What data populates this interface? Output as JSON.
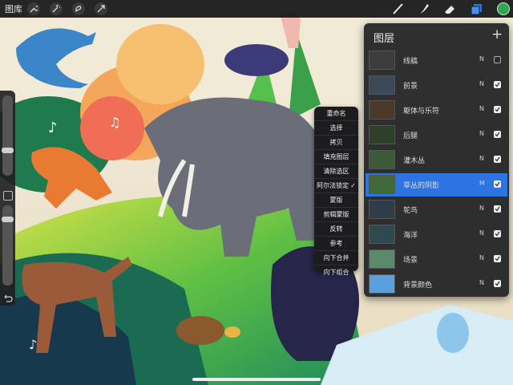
{
  "topbar": {
    "gallery_label": "图库",
    "left_icons": [
      "wrench-icon",
      "magic-wand-icon",
      "selection-icon",
      "transform-icon"
    ],
    "right_tools": [
      "brush-icon",
      "smudge-icon",
      "eraser-icon",
      "layers-icon"
    ],
    "current_color": "#2ea84a"
  },
  "context_menu": {
    "items": [
      {
        "label": "重命名"
      },
      {
        "label": "选择"
      },
      {
        "label": "拷贝"
      },
      {
        "label": "填充图层"
      },
      {
        "label": "清除选区"
      },
      {
        "label": "阿尔法锁定",
        "checked": "✓"
      },
      {
        "label": "蒙版"
      },
      {
        "label": "剪辑蒙版"
      },
      {
        "label": "反转"
      },
      {
        "label": "参考"
      },
      {
        "label": "向下合并"
      },
      {
        "label": "向下组合"
      }
    ]
  },
  "layers_panel": {
    "title": "图层",
    "add_symbol": "+",
    "layers": [
      {
        "name": "线稿",
        "mode": "N",
        "visible": false,
        "selected": false
      },
      {
        "name": "前景",
        "mode": "N",
        "visible": true,
        "selected": false
      },
      {
        "name": "躯体与乐符",
        "mode": "N",
        "visible": true,
        "selected": false
      },
      {
        "name": "后腿",
        "mode": "N",
        "visible": true,
        "selected": false
      },
      {
        "name": "灌木丛",
        "mode": "N",
        "visible": true,
        "selected": false
      },
      {
        "name": "草丛的阴影",
        "mode": "M",
        "visible": true,
        "selected": true
      },
      {
        "name": "鸵鸟",
        "mode": "N",
        "visible": true,
        "selected": false
      },
      {
        "name": "海洋",
        "mode": "N",
        "visible": true,
        "selected": false
      },
      {
        "name": "场景",
        "mode": "N",
        "visible": true,
        "selected": false
      },
      {
        "name": "背景颜色",
        "mode": "N",
        "visible": true,
        "selected": false
      }
    ]
  },
  "sidebar": {
    "brush_size_level": 0.3,
    "opacity_level": 0.85,
    "undo_icon": "undo-icon"
  }
}
